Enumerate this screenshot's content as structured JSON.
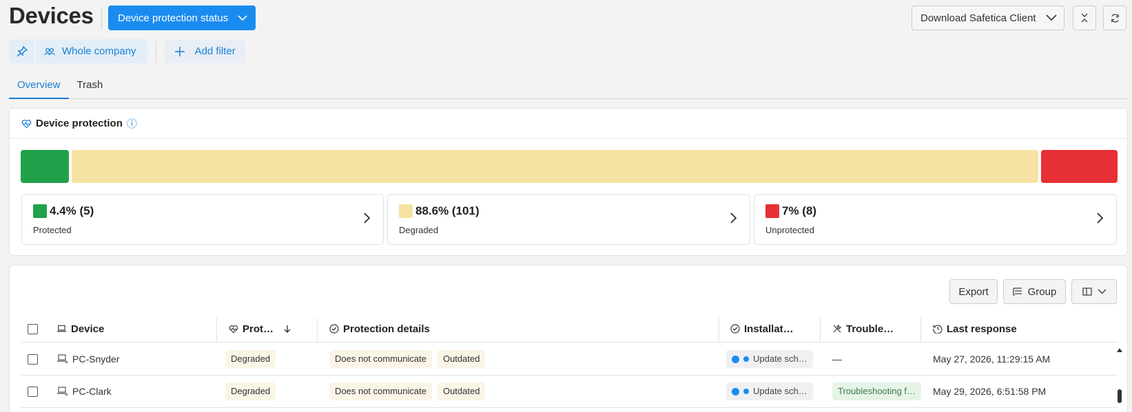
{
  "header": {
    "title": "Devices",
    "status_button": "Device protection status",
    "download_button": "Download Safetica Client"
  },
  "filters": {
    "company": "Whole company",
    "add_filter": "Add filter"
  },
  "tabs": [
    {
      "label": "Overview",
      "active": true
    },
    {
      "label": "Trash",
      "active": false
    }
  ],
  "protection": {
    "title": "Device protection",
    "colors": {
      "protected": "#1fa24a",
      "degraded": "#f6e3a3",
      "unprotected": "#e63035"
    },
    "stats": [
      {
        "value": "4.4% (5)",
        "label": "Protected",
        "percent": 4.4
      },
      {
        "value": "88.6% (101)",
        "label": "Degraded",
        "percent": 88.6
      },
      {
        "value": "7% (8)",
        "label": "Unprotected",
        "percent": 7
      }
    ]
  },
  "table": {
    "export_label": "Export",
    "group_label": "Group",
    "columns": [
      "Device",
      "Prot…",
      "Protection details",
      "Installat…",
      "Trouble…",
      "Last response"
    ],
    "rows": [
      {
        "device": "PC-Snyder",
        "protection": "Degraded",
        "details": [
          "Does not communicate",
          "Outdated"
        ],
        "installation": "Update sch…",
        "troubleshooting": "—",
        "last_response": "May 27, 2026, 11:29:15 AM"
      },
      {
        "device": "PC-Clark",
        "protection": "Degraded",
        "details": [
          "Does not communicate",
          "Outdated"
        ],
        "installation": "Update sch…",
        "troubleshooting": "Troubleshooting f…",
        "last_response": "May 29, 2026, 6:51:58 PM"
      }
    ]
  }
}
